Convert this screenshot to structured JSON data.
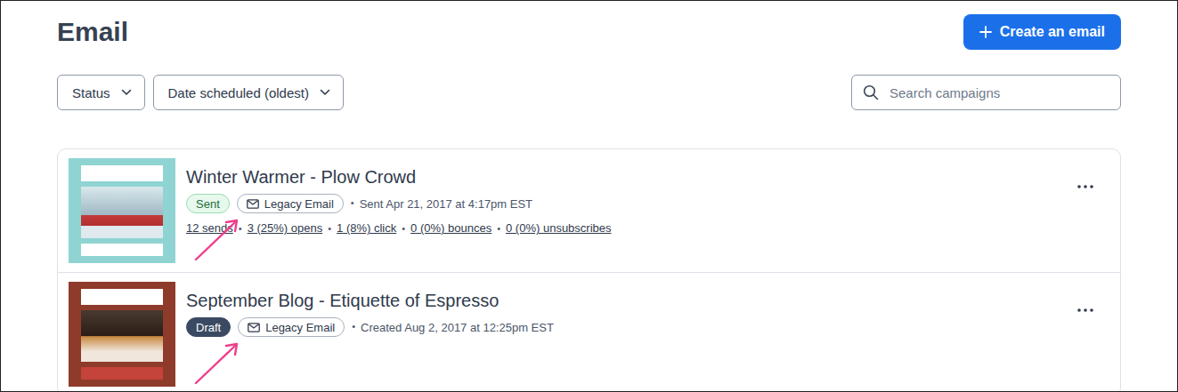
{
  "page": {
    "title": "Email",
    "create_button": "Create an email"
  },
  "filters": [
    {
      "label": "Status"
    },
    {
      "label": "Date scheduled (oldest)"
    }
  ],
  "search": {
    "placeholder": "Search campaigns"
  },
  "separator": "•",
  "emails": [
    {
      "title": "Winter Warmer - Plow Crowd",
      "status": {
        "label": "Sent",
        "kind": "sent"
      },
      "type_badge": "Legacy Email",
      "meta": "Sent Apr 21, 2017 at 4:17pm EST",
      "stats": [
        "12 sends",
        "3 (25%) opens",
        "1 (8%) click",
        "0 (0%) bounces",
        "0 (0%) unsubscribes"
      ],
      "annotated": true
    },
    {
      "title": "September Blog - Etiquette of Espresso",
      "status": {
        "label": "Draft",
        "kind": "draft"
      },
      "type_badge": "Legacy Email",
      "meta": "Created Aug 2, 2017 at 12:25pm EST",
      "stats": [],
      "annotated": true
    }
  ]
}
